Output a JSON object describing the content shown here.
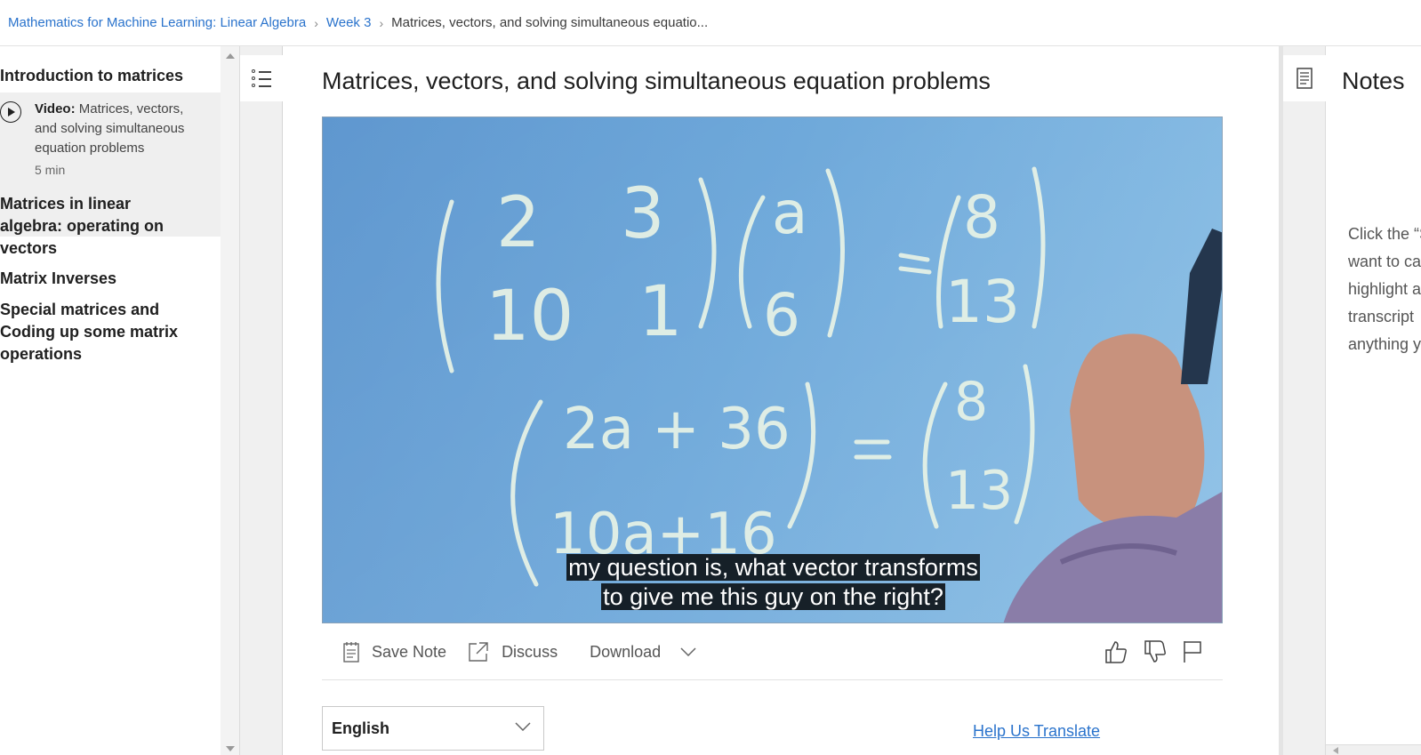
{
  "breadcrumb": {
    "course": "Mathematics for Machine Learning: Linear Algebra",
    "week": "Week 3",
    "current": "Matrices, vectors, and solving simultaneous equatio..."
  },
  "sidebar": {
    "section_intro": "Introduction to matrices",
    "active_lesson": {
      "type_label": "Video:",
      "title": "Matrices, vectors, and solving simultaneous equation problems",
      "duration": "5 min"
    },
    "section_operating": "Matrices in linear algebra: operating on vectors",
    "section_inverses": "Matrix Inverses",
    "section_special": "Special matrices and Coding up some matrix operations"
  },
  "main": {
    "title": "Matrices, vectors, and solving simultaneous equation problems",
    "video": {
      "caption_line1": "my question is, what vector transforms",
      "caption_line2": "to give me this guy on the right?"
    },
    "toolbar": {
      "save_note": "Save Note",
      "discuss": "Discuss",
      "download": "Download"
    },
    "language": "English",
    "help_translate": "Help Us Translate"
  },
  "notes": {
    "title": "Notes",
    "hint_lines": [
      "Click the “S",
      "want to ca",
      "highlight a",
      "transcript",
      "anything y"
    ]
  },
  "colors": {
    "link": "#2a73cc",
    "active_lesson_bg": "#efefef",
    "video_bg": "#6aa6d9"
  }
}
